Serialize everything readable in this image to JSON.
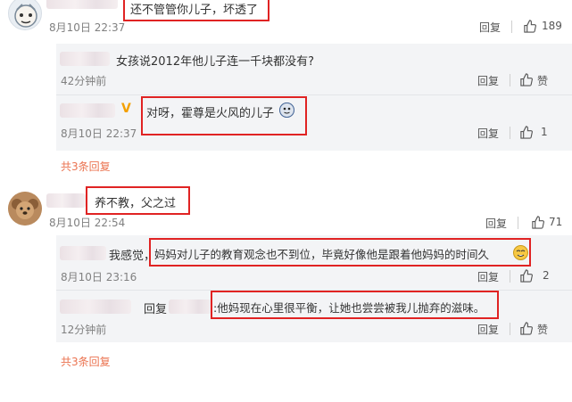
{
  "thread1": {
    "comment": {
      "text": "还不管管你儿子，坏透了",
      "time": "8月10日 22:37",
      "reply_label": "回复",
      "like_count": "189"
    },
    "replies": [
      {
        "text": "女孩说2012年他儿子连一千块都没有?",
        "time": "42分钟前",
        "reply_label": "回复",
        "like_label": "赞"
      },
      {
        "text": "对呀，霍尊是火风的儿子",
        "time": "8月10日 22:37",
        "reply_label": "回复",
        "like_count": "1"
      }
    ],
    "total_replies": "共3条回复"
  },
  "thread2": {
    "comment": {
      "text": "养不教，父之过",
      "time": "8月10日 22:54",
      "reply_label": "回复",
      "like_count": "71"
    },
    "replies": [
      {
        "prefix": "我感觉，",
        "text": "妈妈对儿子的教育观念也不到位，毕竟好像他是跟着他妈妈的时间久",
        "time": "8月10日 23:16",
        "reply_label": "回复",
        "like_count": "2"
      },
      {
        "prefix": "回复",
        "text": ":他妈现在心里很平衡，让她也尝尝被我儿抛弃的滋味。",
        "time": "12分钟前",
        "reply_label": "回复",
        "like_label": "赞"
      }
    ],
    "total_replies": "共3条回复"
  },
  "colors": {
    "highlight": "#e02323",
    "link": "#eb7350",
    "meta": "#808080",
    "reply_bg": "#f3f4f6"
  },
  "icons": {
    "like": "thumbs-up-icon",
    "verified": "verified-v-icon"
  }
}
